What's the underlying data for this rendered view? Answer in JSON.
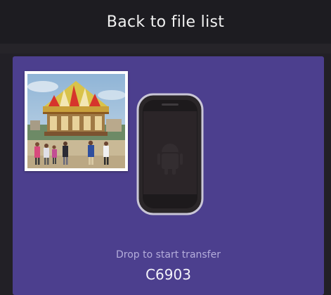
{
  "header": {
    "back_label": "Back to file list"
  },
  "drop_zone": {
    "instruction": "Drop to start transfer",
    "device_name": "C6903"
  },
  "icons": {
    "phone": "smartphone-icon",
    "android": "android-logo-icon",
    "photo": "carousel-photo-thumbnail"
  },
  "colors": {
    "header_bg": "#1d1c21",
    "panel_bg": "#4c3f8e",
    "label_text": "#b4addb",
    "device_text": "#f4f3fa"
  }
}
